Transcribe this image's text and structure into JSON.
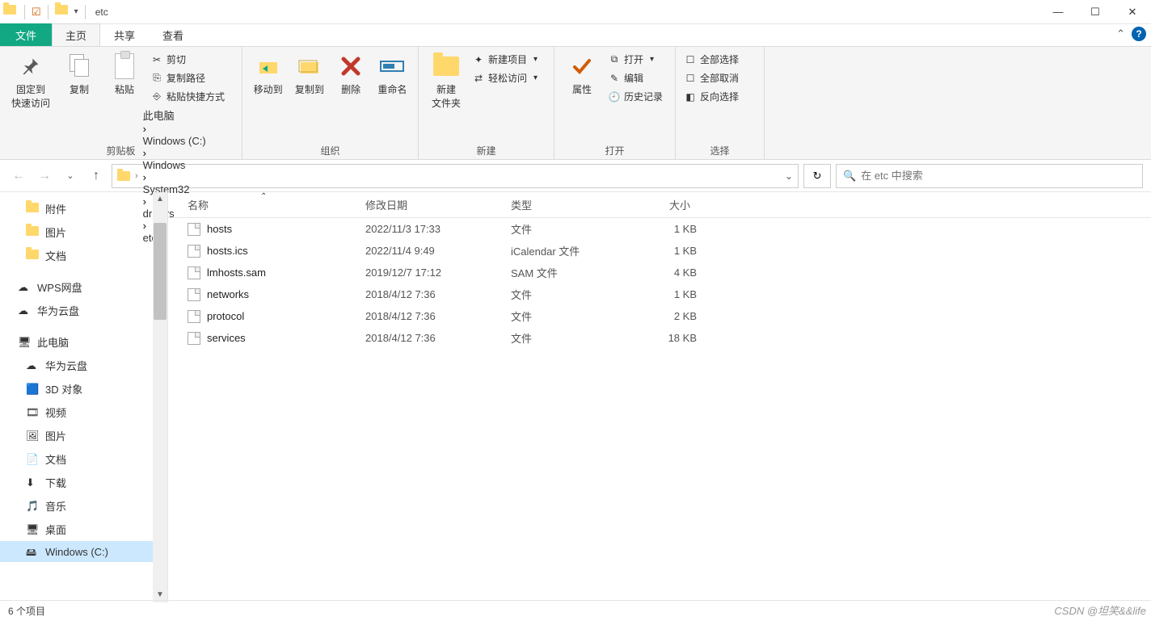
{
  "window": {
    "title": "etc"
  },
  "tabs": {
    "file": "文件",
    "home": "主页",
    "share": "共享",
    "view": "查看"
  },
  "ribbon": {
    "groups": {
      "clipboard": {
        "label": "剪贴板",
        "pin": "固定到\n快速访问",
        "copy": "复制",
        "paste": "粘贴",
        "cut": "剪切",
        "copypath": "复制路径",
        "pasteshortcut": "粘贴快捷方式"
      },
      "organize": {
        "label": "组织",
        "moveto": "移动到",
        "copyto": "复制到",
        "delete": "删除",
        "rename": "重命名"
      },
      "new": {
        "label": "新建",
        "newfolder": "新建\n文件夹",
        "newitem": "新建项目",
        "easyaccess": "轻松访问"
      },
      "open": {
        "label": "打开",
        "properties": "属性",
        "open": "打开",
        "edit": "编辑",
        "history": "历史记录"
      },
      "select": {
        "label": "选择",
        "selectall": "全部选择",
        "selectnone": "全部取消",
        "invert": "反向选择"
      }
    }
  },
  "breadcrumbs": [
    "此电脑",
    "Windows (C:)",
    "Windows",
    "System32",
    "drivers",
    "etc"
  ],
  "search": {
    "placeholder": "在 etc 中搜索"
  },
  "sidebar": {
    "top": [
      {
        "label": "附件",
        "icon": "folder"
      },
      {
        "label": "图片",
        "icon": "folder"
      },
      {
        "label": "文档",
        "icon": "folder"
      }
    ],
    "cloud": [
      {
        "label": "WPS网盘",
        "icon": "cloud-blue"
      },
      {
        "label": "华为云盘",
        "icon": "cloud-blue"
      }
    ],
    "pc_label": "此电脑",
    "pc_children": [
      {
        "label": "华为云盘",
        "icon": "cloud"
      },
      {
        "label": "3D 对象",
        "icon": "3d"
      },
      {
        "label": "视频",
        "icon": "video"
      },
      {
        "label": "图片",
        "icon": "pic"
      },
      {
        "label": "文档",
        "icon": "doc"
      },
      {
        "label": "下载",
        "icon": "dl"
      },
      {
        "label": "音乐",
        "icon": "music"
      },
      {
        "label": "桌面",
        "icon": "desk"
      },
      {
        "label": "Windows (C:)",
        "icon": "drive",
        "selected": true
      }
    ]
  },
  "columns": {
    "name": "名称",
    "date": "修改日期",
    "type": "类型",
    "size": "大小"
  },
  "files": [
    {
      "name": "hosts",
      "date": "2022/11/3 17:33",
      "type": "文件",
      "size": "1 KB"
    },
    {
      "name": "hosts.ics",
      "date": "2022/11/4 9:49",
      "type": "iCalendar 文件",
      "size": "1 KB"
    },
    {
      "name": "lmhosts.sam",
      "date": "2019/12/7 17:12",
      "type": "SAM 文件",
      "size": "4 KB"
    },
    {
      "name": "networks",
      "date": "2018/4/12 7:36",
      "type": "文件",
      "size": "1 KB"
    },
    {
      "name": "protocol",
      "date": "2018/4/12 7:36",
      "type": "文件",
      "size": "2 KB"
    },
    {
      "name": "services",
      "date": "2018/4/12 7:36",
      "type": "文件",
      "size": "18 KB"
    }
  ],
  "status": {
    "count": "6 个项目"
  },
  "watermark": "CSDN @坦笑&&life"
}
